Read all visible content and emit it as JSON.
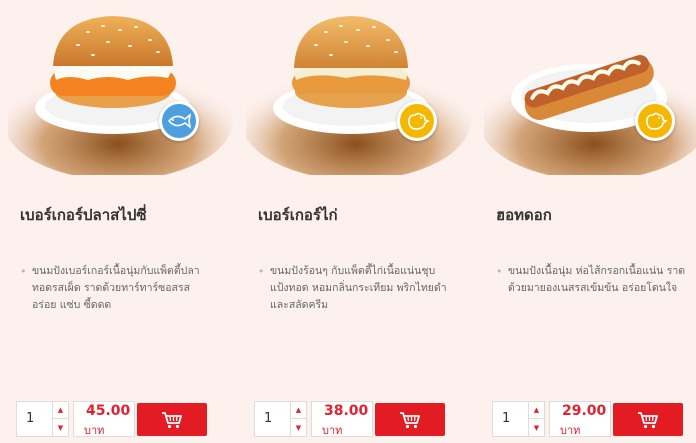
{
  "currency_unit": "บาท",
  "colors": {
    "accent": "#e31b23",
    "fish_badge": "#4d9fe0",
    "chicken_badge": "#f5b800"
  },
  "products": [
    {
      "name": "เบอร์เกอร์ปลาสไปซี่",
      "desc": [
        "ขนมปังเบอร์เกอร์เนื้อนุ่มกับแพ็ตตี้ปลา",
        "ทอดรสเผ็ด ราดด้วยทาร์ทาร์ซอสรส",
        "อร่อย แซ่บ ซี้ดดด"
      ],
      "qty": "1",
      "price": "45.00",
      "badge_icon": "fish-icon"
    },
    {
      "name": "เบอร์เกอร์ไก่",
      "desc": [
        "ขนมปังร้อนๆ กับแพ็ตตี้ไก่เนื้อแน่นชุบ",
        "แป้งทอด หอมกลิ่นกระเทียม พริกไทยดำ",
        "และสลัดครีม"
      ],
      "qty": "1",
      "price": "38.00",
      "badge_icon": "chicken-icon"
    },
    {
      "name": "ฮอทดอก",
      "desc": [
        "ขนมปังเนื้อนุ่ม ห่อไส้กรอกเนื้อแน่น ราด",
        "ด้วยมายองเนสรสเข้มข้น อร่อยโดนใจ"
      ],
      "qty": "1",
      "price": "29.00",
      "badge_icon": "chicken-icon"
    }
  ]
}
